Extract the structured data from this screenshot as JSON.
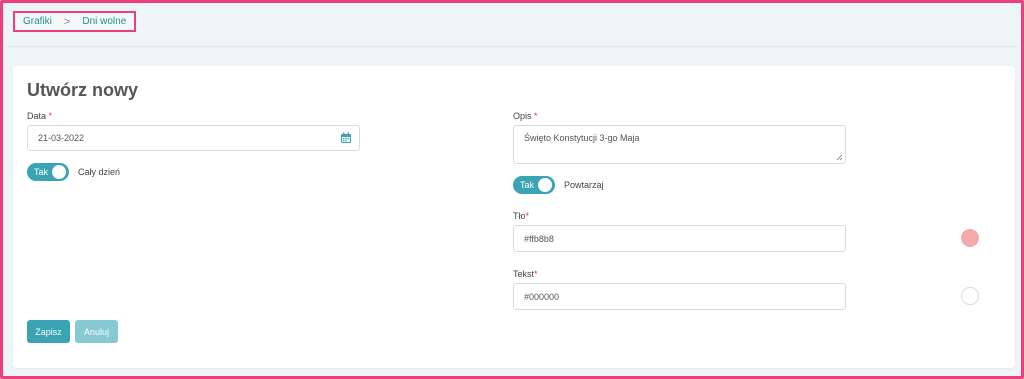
{
  "breadcrumb": {
    "items": [
      "Grafiki",
      "Dni wolne"
    ],
    "separator": ">"
  },
  "form": {
    "title": "Utwórz nowy",
    "date": {
      "label": "Data",
      "required_mark": "*",
      "value": "21-03-2022"
    },
    "all_day": {
      "toggle_label": "Tak",
      "text": "Cały dzień",
      "on": true
    },
    "description": {
      "label": "Opis",
      "required_mark": "*",
      "value": "Święto Konstytucji 3-go Maja"
    },
    "repeat": {
      "toggle_label": "Tak",
      "text": "Powtarzaj",
      "on": true
    },
    "background": {
      "label": "Tło",
      "required_mark": "*",
      "value": "#ffb8b8",
      "swatch_color": "#f4a9ab"
    },
    "text_color": {
      "label": "Tekst",
      "required_mark": "*",
      "value": "#000000",
      "swatch_color": "#ffffff"
    },
    "buttons": {
      "save": "Zapisz",
      "cancel": "Anuluj"
    }
  },
  "colors": {
    "accent": "#3aa3b4",
    "highlight": "#ec3f7c",
    "save_button": "#3aa3b4",
    "cancel_button": "#86c9d3"
  }
}
